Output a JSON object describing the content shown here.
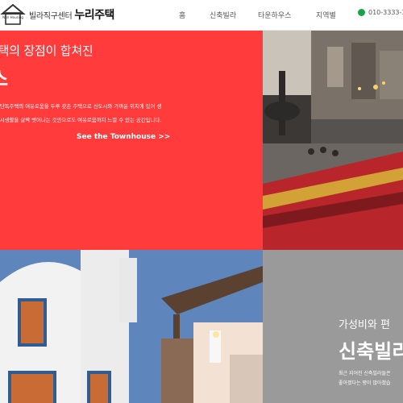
{
  "header": {
    "logo": {
      "badge": "Nuri Housing",
      "subtitle": "빌라직구센터",
      "name": "누리주택"
    },
    "nav": [
      {
        "label": "홈"
      },
      {
        "label": "신축빌라"
      },
      {
        "label": "타운하우스"
      },
      {
        "label": "지역별"
      }
    ],
    "phone": "010-3333-3"
  },
  "sections": {
    "townhouse": {
      "subtitle": "주택의 장점이 합쳐진",
      "title": "스",
      "description_line1": "점과 단독주택의 여유로움을 두루 갖춘 주택으로 신도시와 가까운 위치에 있어 생",
      "description_line2": "한 도시생활을 살짝 벗어나는 것만으로도 여유로움까지 느낄 수 있는 공간입니다.",
      "link": "See the Townhouse >>",
      "color": "#ff3b3c"
    },
    "newvilla": {
      "subtitle": "가성비와 편",
      "title": "신축빌리",
      "description_line1": "최근 지어진 신축빌라들은",
      "description_line2": "좋아졌다는 평이 많아졌습",
      "color": "#9a9a9a"
    }
  }
}
